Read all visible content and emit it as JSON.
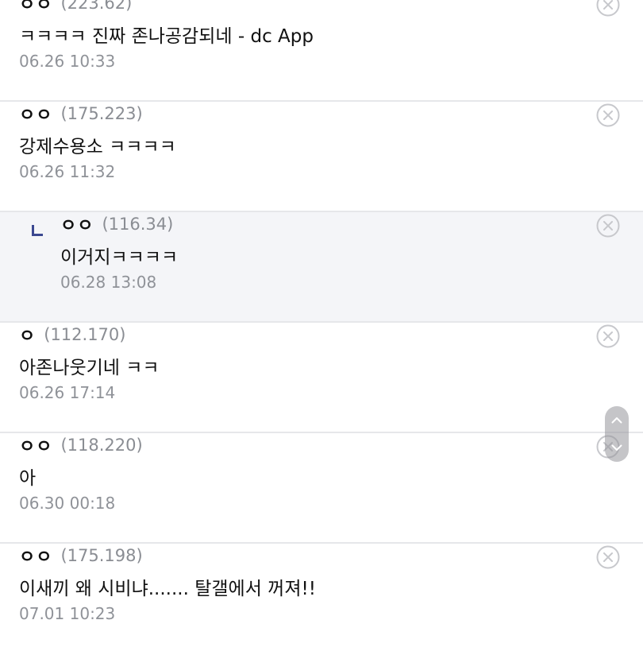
{
  "comments": [
    {
      "nick": "ㅇㅇ",
      "ip": "(223.62)",
      "text": "ㅋㅋㅋㅋ 진짜 존나공감되네 - dc App",
      "date": "06.26 10:33",
      "reply": false
    },
    {
      "nick": "ㅇㅇ",
      "ip": "(175.223)",
      "text": "강제수용소 ㅋㅋㅋㅋ",
      "date": "06.26 11:32",
      "reply": false
    },
    {
      "nick": "ㅇㅇ",
      "ip": "(116.34)",
      "text": "이거지ㅋㅋㅋㅋ",
      "date": "06.28 13:08",
      "reply": true
    },
    {
      "nick": "ㅇ",
      "ip": "(112.170)",
      "text": "아존나웃기네 ㅋㅋ",
      "date": "06.26 17:14",
      "reply": false
    },
    {
      "nick": "ㅇㅇ",
      "ip": "(118.220)",
      "text": "아",
      "date": "06.30 00:18",
      "reply": false
    },
    {
      "nick": "ㅇㅇ",
      "ip": "(175.198)",
      "text": "이새끼 왜 시비냐....... 탈갤에서 꺼져!!",
      "date": "07.01 10:23",
      "reply": false
    }
  ],
  "icons": {
    "delete": "close-circle-icon",
    "reply": "reply-arrow-icon",
    "scroll_up": "chevron-up-icon",
    "scroll_down": "chevron-down-icon"
  },
  "colors": {
    "reply_background": "#f4f5f8",
    "reply_marker": "#3b4890",
    "meta_text": "#8f9298",
    "divider": "#e6e7ea"
  }
}
